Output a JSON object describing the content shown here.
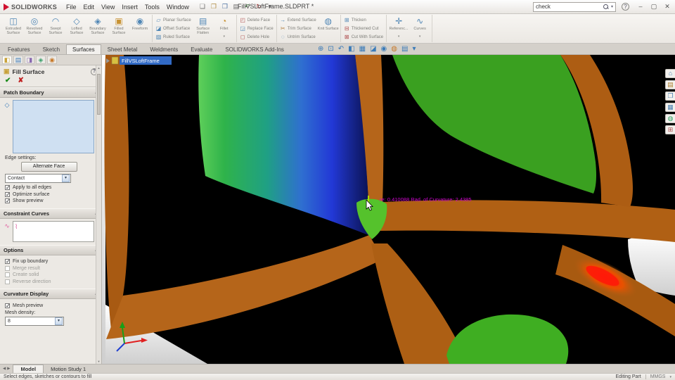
{
  "titlebar": {
    "brand": "SOLIDWORKS",
    "menus": [
      {
        "label": "File"
      },
      {
        "label": "Edit"
      },
      {
        "label": "View"
      },
      {
        "label": "Insert"
      },
      {
        "label": "Tools"
      },
      {
        "label": "Window"
      }
    ],
    "quick_access": [
      {
        "icon": "new-file-icon",
        "glyph": "❏",
        "color": "#6a6a6a"
      },
      {
        "icon": "open-file-icon",
        "glyph": "❐",
        "color": "#b08a40"
      },
      {
        "icon": "save-icon",
        "glyph": "❒",
        "color": "#4a6fa0"
      },
      {
        "icon": "print-icon",
        "glyph": "▤",
        "color": "#6a6a6a"
      },
      {
        "icon": "undo-icon",
        "glyph": "↶",
        "color": "#3a7a3a"
      },
      {
        "icon": "rebuild-icon",
        "glyph": "↻",
        "color": "#a04a4a"
      },
      {
        "icon": "options-gear-icon",
        "glyph": "▾",
        "color": "#6a6a6a"
      }
    ],
    "document_title": "FillVSLoftFrame.SLDPRT *",
    "search_value": "check",
    "help_label": "?",
    "window_buttons": [
      {
        "icon": "minimize-icon",
        "glyph": "–"
      },
      {
        "icon": "maximize-icon",
        "glyph": "▢"
      },
      {
        "icon": "close-icon",
        "glyph": "✕"
      }
    ]
  },
  "ribbon": {
    "g1": [
      {
        "label": "Extruded Surface",
        "icon": "extruded-surface-icon",
        "glyph": "◫",
        "color": "#4f86b5"
      },
      {
        "label": "Revolved Surface",
        "icon": "revolved-surface-icon",
        "glyph": "◎",
        "color": "#4f86b5"
      },
      {
        "label": "Swept Surface",
        "icon": "swept-surface-icon",
        "glyph": "◠",
        "color": "#4f86b5"
      },
      {
        "label": "Lofted Surface",
        "icon": "lofted-surface-icon",
        "glyph": "◇",
        "color": "#4f86b5"
      },
      {
        "label": "Boundary Surface",
        "icon": "boundary-surface-icon",
        "glyph": "◈",
        "color": "#4f86b5"
      },
      {
        "label": "Filled Surface",
        "icon": "filled-surface-icon",
        "glyph": "▣",
        "color": "#c89232"
      },
      {
        "label": "Freeform",
        "icon": "freeform-icon",
        "glyph": "◉",
        "color": "#4f86b5"
      }
    ],
    "g2_small": [
      {
        "label": "Planar Surface",
        "icon": "planar-surface-icon",
        "glyph": "▱",
        "color": "#4f86b5"
      },
      {
        "label": "Offset Surface",
        "icon": "offset-surface-icon",
        "glyph": "◪",
        "color": "#4f86b5"
      },
      {
        "label": "Ruled Surface",
        "icon": "ruled-surface-icon",
        "glyph": "▨",
        "color": "#4f86b5"
      }
    ],
    "g2_big": [
      {
        "label": "Surface Flatten",
        "icon": "surface-flatten-icon",
        "glyph": "▤",
        "color": "#4f86b5"
      },
      {
        "label": "Fillet",
        "icon": "fillet-icon",
        "glyph": "◔",
        "color": "#c89232",
        "arrow": "▾"
      }
    ],
    "g3": [
      {
        "label": "Delete Face",
        "icon": "delete-face-icon",
        "glyph": "◰",
        "color": "#b05050"
      },
      {
        "label": "Replace Face",
        "icon": "replace-face-icon",
        "glyph": "◲",
        "color": "#4f86b5"
      },
      {
        "label": "Delete Hole",
        "icon": "delete-hole-icon",
        "glyph": "◻",
        "color": "#b05050"
      }
    ],
    "g4_small": [
      {
        "label": "Extend Surface",
        "icon": "extend-surface-icon",
        "glyph": "→",
        "color": "#4f86b5"
      },
      {
        "label": "Trim Surface",
        "icon": "trim-surface-icon",
        "glyph": "✂",
        "color": "#b07a3a"
      },
      {
        "label": "Untrim Surface",
        "icon": "untrim-surface-icon",
        "glyph": "◌",
        "color": "#4f86b5"
      }
    ],
    "g4_big": [
      {
        "label": "Knit Surface",
        "icon": "knit-surface-icon",
        "glyph": "◍",
        "color": "#4f86b5"
      }
    ],
    "g5": [
      {
        "label": "Thicken",
        "icon": "thicken-icon",
        "glyph": "⊞",
        "color": "#4f86b5"
      },
      {
        "label": "Thickened Cut",
        "icon": "thickened-cut-icon",
        "glyph": "⊟",
        "color": "#b05050"
      },
      {
        "label": "Cut With Surface",
        "icon": "cut-with-surface-icon",
        "glyph": "⊠",
        "color": "#b05050"
      }
    ],
    "g6": [
      {
        "label": "Referenc...",
        "icon": "reference-geometry-icon",
        "glyph": "✛",
        "color": "#4f86b5",
        "arrow": "▾"
      },
      {
        "label": "Curves",
        "icon": "curves-icon",
        "glyph": "∿",
        "color": "#4f86b5",
        "arrow": "▾"
      }
    ]
  },
  "tabs": [
    {
      "label": "Features",
      "active": false
    },
    {
      "label": "Sketch",
      "active": false
    },
    {
      "label": "Surfaces",
      "active": true
    },
    {
      "label": "Sheet Metal",
      "active": false
    },
    {
      "label": "Weldments",
      "active": false
    },
    {
      "label": "Evaluate",
      "active": false
    },
    {
      "label": "SOLIDWORKS Add-Ins",
      "active": false
    }
  ],
  "headsup": [
    {
      "icon": "zoom-fit-icon",
      "glyph": "⊕",
      "color": "#3a7ab8"
    },
    {
      "icon": "zoom-area-icon",
      "glyph": "⊡",
      "color": "#3a7ab8"
    },
    {
      "icon": "previous-view-icon",
      "glyph": "↶",
      "color": "#3a7ab8"
    },
    {
      "icon": "section-view-icon",
      "glyph": "◧",
      "color": "#3a7ab8"
    },
    {
      "icon": "view-orientation-icon",
      "glyph": "▦",
      "color": "#3a7ab8"
    },
    {
      "icon": "display-style-icon",
      "glyph": "◪",
      "color": "#3a7ab8"
    },
    {
      "icon": "hide-show-icon",
      "glyph": "◉",
      "color": "#3a7ab8"
    },
    {
      "icon": "edit-appearance-icon",
      "glyph": "◍",
      "color": "#c87a2a"
    },
    {
      "icon": "apply-scene-icon",
      "glyph": "▤",
      "color": "#3a7ab8"
    },
    {
      "icon": "view-settings-icon",
      "glyph": "▾",
      "color": "#3a7ab8"
    }
  ],
  "property_manager": {
    "tabs": [
      {
        "icon": "propertymanager-tab-icon",
        "glyph": "◧",
        "color": "#c8a23a"
      },
      {
        "icon": "featuremanager-tab-icon",
        "glyph": "▤",
        "color": "#3a7ab8"
      },
      {
        "icon": "configurations-tab-icon",
        "glyph": "◨",
        "color": "#8a6ab0"
      },
      {
        "icon": "dimxpert-tab-icon",
        "glyph": "◈",
        "color": "#3aa06a"
      },
      {
        "icon": "display-manager-tab-icon",
        "glyph": "◉",
        "color": "#c87a2a"
      }
    ],
    "title": "Fill Surface",
    "help_glyph": "?",
    "ok_glyph": "✔",
    "cancel_glyph": "✘",
    "patch_boundary": {
      "title": "Patch Boundary",
      "edge_settings_label": "Edge settings:",
      "alternate_face_label": "Alternate Face",
      "curvature_control_value": "Contact",
      "checkboxes": [
        {
          "label": "Apply to all edges",
          "checked": true,
          "enabled": true
        },
        {
          "label": "Optimize surface",
          "checked": true,
          "enabled": true
        },
        {
          "label": "Show preview",
          "checked": true,
          "enabled": true
        }
      ]
    },
    "constraint_curves": {
      "title": "Constraint Curves"
    },
    "options": {
      "title": "Options",
      "checkboxes": [
        {
          "label": "Fix up boundary",
          "checked": true,
          "enabled": true
        },
        {
          "label": "Merge result",
          "checked": false,
          "enabled": false
        },
        {
          "label": "Create solid",
          "checked": false,
          "enabled": false
        },
        {
          "label": "Reverse direction",
          "checked": false,
          "enabled": false
        }
      ]
    },
    "curvature_display": {
      "title": "Curvature Display",
      "checkboxes": [
        {
          "label": "Mesh preview",
          "checked": true,
          "enabled": true
        }
      ],
      "mesh_density_label": "Mesh density:",
      "mesh_density_value": "8"
    }
  },
  "viewport": {
    "flyout_label": "FillVSLoftFrame",
    "curvature_readout": "re: 0.410088   Rad. of Curvature: 2.4385",
    "colors": {
      "frame_orange": "#b05f16",
      "model_black": "#000000",
      "patch_green": "#55c22c",
      "curvature_green": "#2fb34a",
      "curvature_blue": "#2238d6",
      "hot_spot_red": "#ff2010"
    }
  },
  "taskpane": [
    {
      "icon": "solidworks-resources-icon",
      "glyph": "⌂",
      "color": "#4a7fb0"
    },
    {
      "icon": "design-library-icon",
      "glyph": "▤",
      "color": "#b08030"
    },
    {
      "icon": "file-explorer-icon",
      "glyph": "❐",
      "color": "#4a7fb0"
    },
    {
      "icon": "view-palette-icon",
      "glyph": "▦",
      "color": "#4a7fb0"
    },
    {
      "icon": "appearances-icon",
      "glyph": "◍",
      "color": "#30a060"
    },
    {
      "icon": "custom-properties-icon",
      "glyph": "⊞",
      "color": "#b05050"
    }
  ],
  "dock": {
    "nav": [
      {
        "icon": "tab-scroll-left-icon",
        "glyph": "◀"
      },
      {
        "icon": "tab-scroll-right-icon",
        "glyph": "▶"
      }
    ],
    "tabs": [
      {
        "label": "Model",
        "active": true
      },
      {
        "label": "Motion Study 1",
        "active": false
      }
    ]
  },
  "statusbar": {
    "message": "Select edges, sketches or contours to fill",
    "editing_label": "Editing Part",
    "units_label": "MMGS",
    "units_arrow": "▾"
  }
}
